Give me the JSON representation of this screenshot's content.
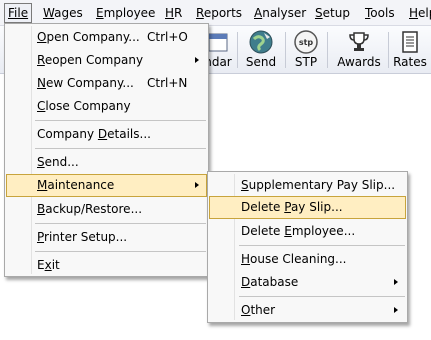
{
  "menubar": {
    "items": [
      {
        "label": "File",
        "u": "F"
      },
      {
        "label": "Wages",
        "u": "W"
      },
      {
        "label": "Employee",
        "u": "E"
      },
      {
        "label": "HR",
        "u": "H"
      },
      {
        "label": "Reports",
        "u": "R"
      },
      {
        "label": "Analyser",
        "u": "A"
      },
      {
        "label": "Setup",
        "u": "S"
      },
      {
        "label": "Tools",
        "u": "T"
      },
      {
        "label": "Help",
        "u": "H"
      }
    ]
  },
  "toolbar": {
    "buttons": [
      {
        "label": "ndar",
        "icon": "calendar-icon"
      },
      {
        "label": "Send",
        "icon": "globe-send-icon"
      },
      {
        "label": "STP",
        "icon": "stp-icon",
        "icon_text": "stp"
      },
      {
        "label": "Awards",
        "icon": "trophy-icon"
      },
      {
        "label": "Rates",
        "icon": "rates-table-icon"
      }
    ]
  },
  "file_menu": {
    "items": [
      {
        "pre": "",
        "u": "O",
        "post": "pen Company...",
        "shortcut": "Ctrl+O"
      },
      {
        "pre": "",
        "u": "R",
        "post": "eopen Company",
        "submenu": true
      },
      {
        "pre": "",
        "u": "N",
        "post": "ew Company...",
        "shortcut": "Ctrl+N"
      },
      {
        "pre": "",
        "u": "C",
        "post": "lose Company"
      },
      {
        "pre": "Company ",
        "u": "D",
        "post": "etails..."
      },
      {
        "pre": "",
        "u": "S",
        "post": "end..."
      },
      {
        "pre": "",
        "u": "M",
        "post": "aintenance",
        "submenu": true,
        "highlighted": true
      },
      {
        "pre": "",
        "u": "B",
        "post": "ackup/Restore..."
      },
      {
        "pre": "",
        "u": "P",
        "post": "rinter Setup..."
      },
      {
        "pre": "E",
        "u": "x",
        "post": "it"
      }
    ]
  },
  "maintenance_menu": {
    "items": [
      {
        "pre": "",
        "u": "S",
        "post": "upplementary Pay Slip..."
      },
      {
        "pre": "Delete ",
        "u": "P",
        "post": "ay Slip...",
        "highlighted": true
      },
      {
        "pre": "Delete ",
        "u": "E",
        "post": "mployee..."
      },
      {
        "pre": "",
        "u": "H",
        "post": "ouse Cleaning..."
      },
      {
        "pre": "",
        "u": "D",
        "post": "atabase",
        "submenu": true
      },
      {
        "pre": "",
        "u": "O",
        "post": "ther",
        "submenu": true
      }
    ]
  }
}
